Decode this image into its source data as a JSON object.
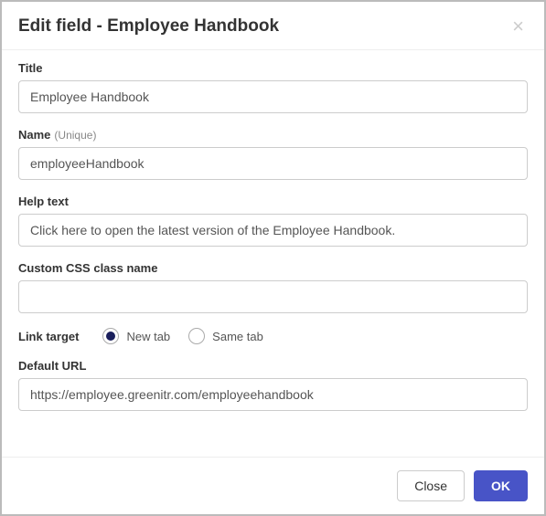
{
  "header": {
    "title": "Edit field - Employee Handbook"
  },
  "fields": {
    "title": {
      "label": "Title",
      "value": "Employee Handbook"
    },
    "name": {
      "label": "Name",
      "hint": "(Unique)",
      "value": "employeeHandbook"
    },
    "helpText": {
      "label": "Help text",
      "value": "Click here to open the latest version of the Employee Handbook."
    },
    "cssClass": {
      "label": "Custom CSS class name",
      "value": ""
    },
    "linkTarget": {
      "label": "Link target",
      "options": {
        "newTab": "New tab",
        "sameTab": "Same tab"
      },
      "selected": "newTab"
    },
    "defaultUrl": {
      "label": "Default URL",
      "value": "https://employee.greenitr.com/employeehandbook"
    }
  },
  "footer": {
    "close": "Close",
    "ok": "OK"
  }
}
